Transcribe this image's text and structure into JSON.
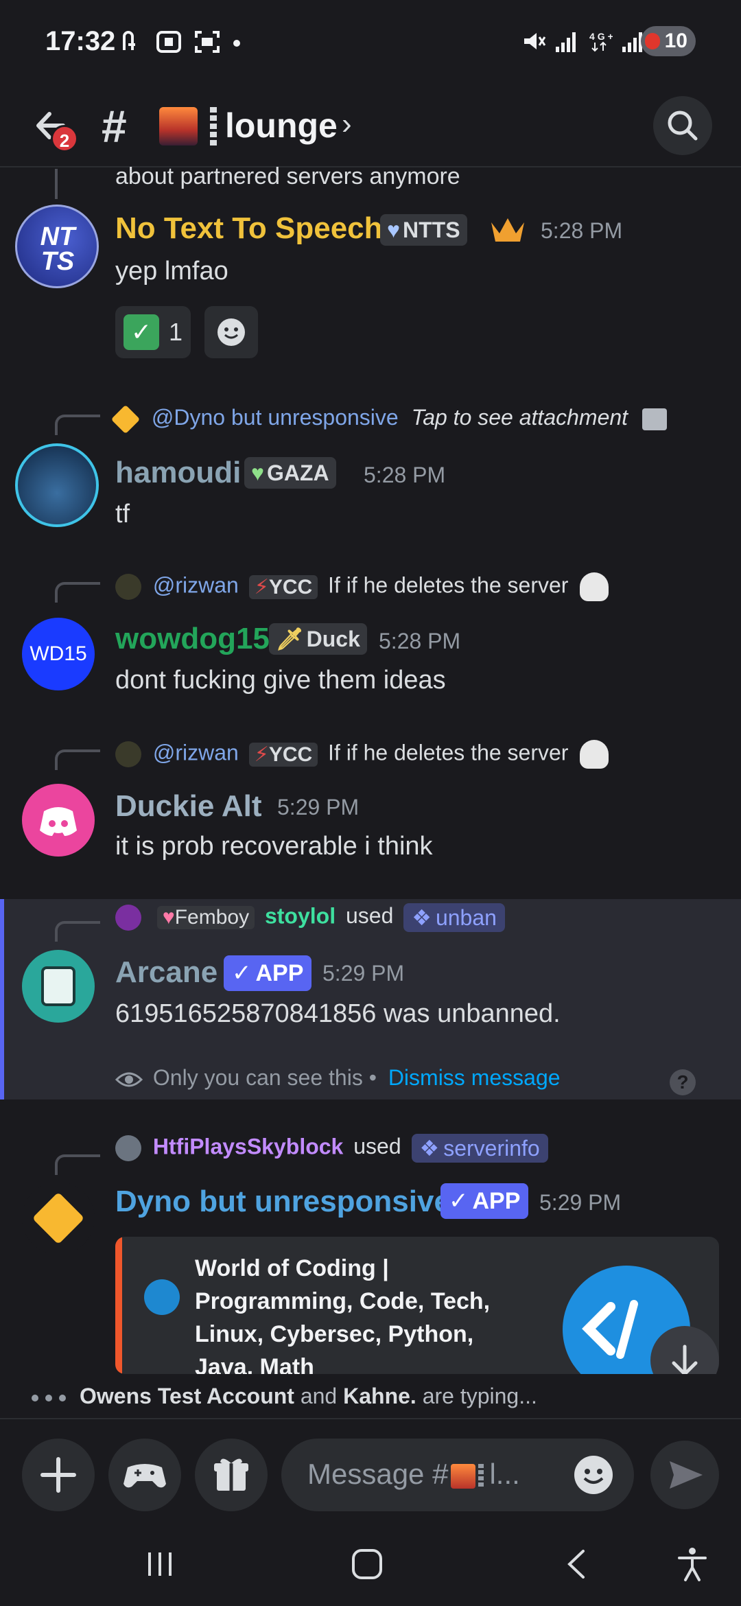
{
  "status_bar": {
    "time": "17:32",
    "battery": "10"
  },
  "header": {
    "unread_badge": "2",
    "channel_name": "lounge"
  },
  "messages": {
    "m0": {
      "continuation_text": "about partnered servers anymore"
    },
    "m1": {
      "avatar_text": "NT TS",
      "username": "No Text To Speech",
      "tag": "NTTS",
      "timestamp": "5:28 PM",
      "text": "yep lmfao",
      "reaction_count": "1"
    },
    "m2": {
      "reply_mention": "@Dyno but unresponsive",
      "reply_text": "Tap to see attachment",
      "username": "hamoudi",
      "tag": "GAZA",
      "timestamp": "5:28 PM",
      "text": "tf"
    },
    "m3": {
      "reply_mention": "@rizwan",
      "reply_tag": "YCC",
      "reply_text": "If if he deletes the server",
      "avatar_text": "WD15",
      "username": "wowdog15",
      "tag": "Duck",
      "timestamp": "5:28 PM",
      "text": "dont fucking give them ideas"
    },
    "m4": {
      "reply_mention": "@rizwan",
      "reply_tag": "YCC",
      "reply_text": "If if he deletes the server",
      "username": "Duckie Alt",
      "timestamp": "5:29 PM",
      "text": "it is prob recoverable i think"
    },
    "m5": {
      "reply_tag": "Femboy",
      "reply_user": "stoylol",
      "reply_used": "used",
      "reply_command": "unban",
      "username": "Arcane",
      "app_tag": "APP",
      "timestamp": "5:29 PM",
      "text": "619516525870841856 was unbanned.",
      "ephemeral_note": "Only you can see this •",
      "dismiss_label": "Dismiss message"
    },
    "m6": {
      "reply_user": "HtfiPlaysSkyblock",
      "reply_used": "used",
      "reply_command": "serverinfo",
      "username": "Dyno but unresponsive",
      "app_tag": "APP",
      "timestamp": "5:29 PM",
      "embed_title": "World of Coding | Programming, Code, Tech, Linux, Cybersec, Python, Java, Math"
    }
  },
  "typing": {
    "user1": "Owens Test Account",
    "and": "and",
    "user2": "Kahne.",
    "suffix": "are typing..."
  },
  "composer": {
    "placeholder_prefix": "Message #",
    "placeholder_suffix": "l..."
  },
  "colors": {
    "background": "#1a1a1e",
    "blurple": "#5865f2",
    "ntts_name": "#f0c23b",
    "hamoudi_name": "#8aa3b3",
    "wowdog_name": "#23a55a",
    "duckie_name": "#9db0c0",
    "arcane_name": "#8aa3b3",
    "dyno_name": "#4fa3e0",
    "stoylol_name": "#3ee0a0",
    "htfi_name": "#c28bff",
    "mention": "#7fa6e8",
    "embed_border": "#f0572c"
  }
}
